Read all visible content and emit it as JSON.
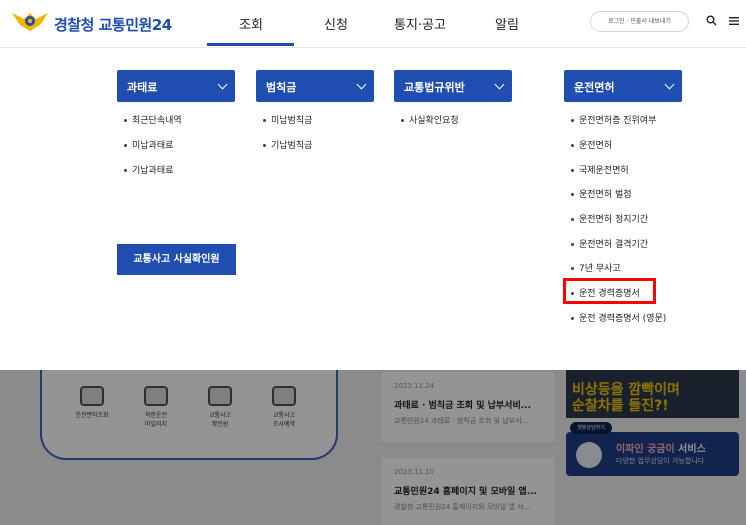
{
  "header": {
    "site_name": "경찰청 교통민원24",
    "nav": [
      {
        "label": "조회",
        "active": true
      },
      {
        "label": "신청",
        "active": false
      },
      {
        "label": "통지·공고",
        "active": false
      },
      {
        "label": "알림",
        "active": false
      }
    ],
    "login_label": "로그인 · 민출서 내보내기",
    "icons": [
      "police-emblem-icon",
      "search-icon",
      "menu-icon"
    ]
  },
  "mega_menu": {
    "columns": [
      {
        "title": "과태료",
        "items": [
          "최근단속내역",
          "미납과태료",
          "기납과태료"
        ]
      },
      {
        "title": "범칙금",
        "items": [
          "미납범칙금",
          "기납범칙금"
        ]
      },
      {
        "title": "교통법규위반",
        "items": [
          "사실확인요청"
        ]
      },
      {
        "title": "운전면허",
        "items": [
          "운전면허증 진위여부",
          "운전면허",
          "국제운전면허",
          "운전면허 벌점",
          "운전면허 정지기간",
          "운전면허 결격기간",
          "7년 무사고",
          "운전 경력증명서",
          "운전 경력증명서 (영문)"
        ],
        "highlighted_index": 7
      }
    ],
    "accident_button": "교통사고 사실확인원"
  },
  "background": {
    "services": [
      "운전면허조회",
      "착한운전\n마일리지",
      "교통사고\n확인원",
      "교통사고\n조사예약"
    ],
    "news": [
      {
        "date": "2023.11.24",
        "title": "과태료 · 범칙금 조회 및 납부서비...",
        "summary": "교통민원24 과태료 · 범칙금 조회 및 납부서..."
      },
      {
        "date": "2023.11.10",
        "title": "교통민원24 홈페이지 및 모바일 앱...",
        "summary": "경찰청 교통민원24 홈페이지와 모바일 앱 서..."
      }
    ],
    "banner_text": "비상등을 깜빡이며\n순찰차를 돌진?!",
    "chatbot_bubble": "챗봇상담하기",
    "chatbot_title_hl": "이파인 궁금이",
    "chatbot_title": " 서비스",
    "chatbot_sub": "다양한 업무상담이 가능합니다"
  },
  "colors": {
    "brand": "#1f4db0",
    "highlight": "#ff0000"
  }
}
